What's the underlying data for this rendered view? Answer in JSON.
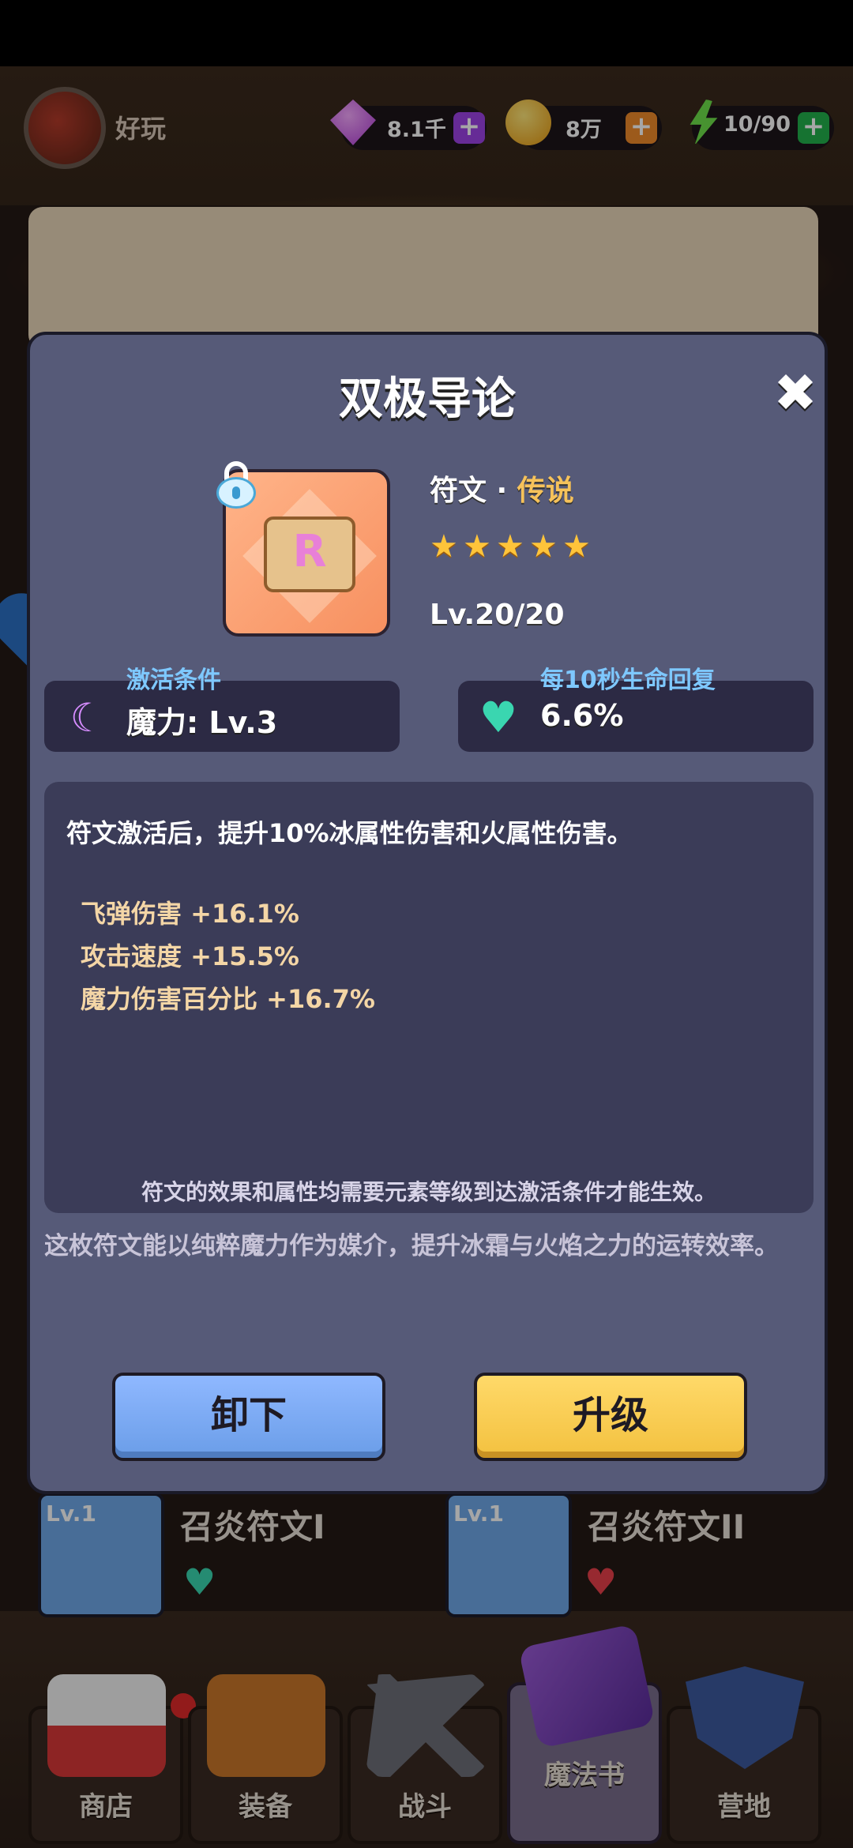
{
  "header": {
    "player_name": "好玩",
    "resources": [
      {
        "icon": "gem-icon",
        "value": "8.1千",
        "plus_color": "#9d42e6"
      },
      {
        "icon": "gold-coin-icon",
        "value": "8万",
        "plus_color": "#f08a2a"
      },
      {
        "icon": "energy-bolt-icon",
        "value": "10/90",
        "plus_color": "#22b14c"
      }
    ]
  },
  "modal": {
    "title": "双极导论",
    "close": "✖",
    "rarity_prefix": "符文 · ",
    "rarity": "传说",
    "star_count": 5,
    "level": "Lv.20/20",
    "glyph": "R",
    "activation": {
      "label": "激活条件",
      "value": "魔力: Lv.3"
    },
    "regen": {
      "label": "每10秒生命回复",
      "value": "6.6%"
    },
    "description": "符文激活后，提升10%冰属性伤害和火属性伤害。",
    "bonuses": [
      "飞弹伤害 +16.1%",
      "攻击速度 +15.5%",
      "魔力伤害百分比 +16.7%"
    ],
    "note": "符文的效果和属性均需要元素等级到达激活条件才能生效。",
    "flavor": "这枚符文能以纯粹魔力作为媒介，提升冰霜与火焰之力的运转效率。",
    "buttons": {
      "unequip": "卸下",
      "upgrade": "升级"
    }
  },
  "cards": [
    {
      "level": "Lv.1",
      "name": "召炎符文I"
    },
    {
      "level": "Lv.1",
      "name": "召炎符文II"
    }
  ],
  "nav": [
    {
      "label": "商店",
      "icon": "shop-icon"
    },
    {
      "label": "装备",
      "icon": "equipment-icon"
    },
    {
      "label": "战斗",
      "icon": "battle-swords-icon"
    },
    {
      "label": "魔法书",
      "icon": "magic-book-icon",
      "active": true
    },
    {
      "label": "营地",
      "icon": "camp-shield-icon"
    }
  ],
  "colors": {
    "modal_bg": "#565a78",
    "legendary": "#f6c25a",
    "label_blue": "#7ec8ff",
    "bonus_text": "#f4d6a6",
    "unequip_btn": "#8fb8ff",
    "upgrade_btn": "#ffd969"
  }
}
